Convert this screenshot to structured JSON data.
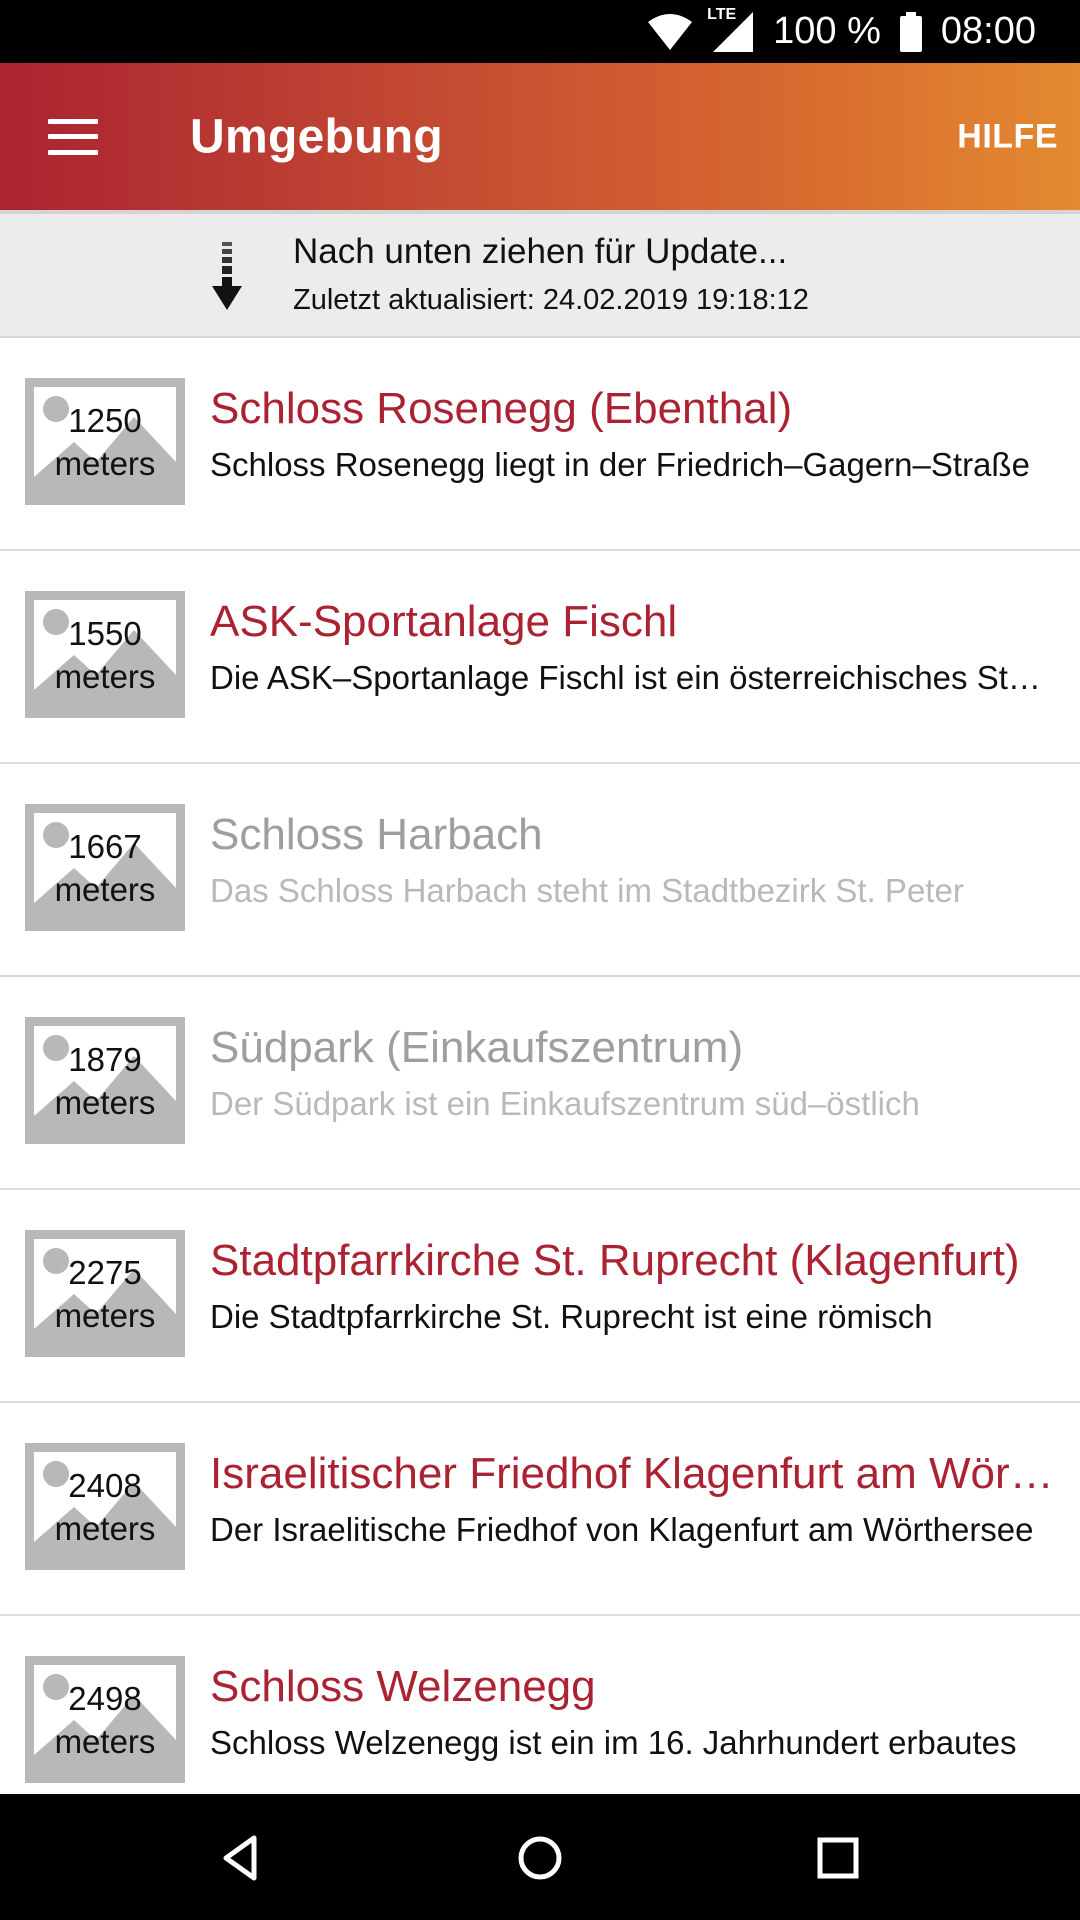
{
  "status_bar": {
    "network": "LTE",
    "battery": "100 %",
    "time": "08:00",
    "icons": [
      "wifi-icon",
      "cell-signal-icon",
      "battery-icon"
    ]
  },
  "app_bar": {
    "title": "Umgebung",
    "help_label": "HILFE",
    "menu_icon": "hamburger-menu-icon"
  },
  "refresh": {
    "title": "Nach unten ziehen für Update...",
    "last_updated": "Zuletzt aktualisiert: 24.02.2019 19:18:12",
    "icon": "pull-down-arrow-icon"
  },
  "colors": {
    "accent": "#ab2332",
    "gradient_end": "#e38a30",
    "dimmed_title": "#9e9e9e"
  },
  "items": [
    {
      "distance": "1250",
      "unit": "meters",
      "title": "Schloss Rosenegg (Ebenthal)",
      "description": "Schloss Rosenegg liegt in der Friedrich–Gagern–Straße",
      "dimmed": false
    },
    {
      "distance": "1550",
      "unit": "meters",
      "title": "ASK-Sportanlage Fischl",
      "description": "Die ASK–Sportanlage Fischl ist ein österreichisches Stadion",
      "dimmed": false
    },
    {
      "distance": "1667",
      "unit": "meters",
      "title": "Schloss Harbach",
      "description": "Das Schloss Harbach steht im Stadtbezirk St. Peter",
      "dimmed": true
    },
    {
      "distance": "1879",
      "unit": "meters",
      "title": "Südpark (Einkaufszentrum)",
      "description": "Der Südpark ist ein Einkaufszentrum süd–östlich",
      "dimmed": true
    },
    {
      "distance": "2275",
      "unit": "meters",
      "title": "Stadtpfarrkirche St. Ruprecht (Klagenfurt)",
      "description": "Die Stadtpfarrkirche St. Ruprecht ist eine römisch",
      "dimmed": false
    },
    {
      "distance": "2408",
      "unit": "meters",
      "title": "Israelitischer Friedhof Klagenfurt am Wörthersee",
      "description": "Der Israelitische Friedhof von Klagenfurt am Wörthersee",
      "dimmed": false
    },
    {
      "distance": "2498",
      "unit": "meters",
      "title": "Schloss Welzenegg",
      "description": "Schloss Welzenegg ist ein im 16. Jahrhundert erbautes",
      "dimmed": false
    }
  ],
  "nav_bar": {
    "icons": [
      "back-icon",
      "home-icon",
      "recents-icon"
    ]
  }
}
